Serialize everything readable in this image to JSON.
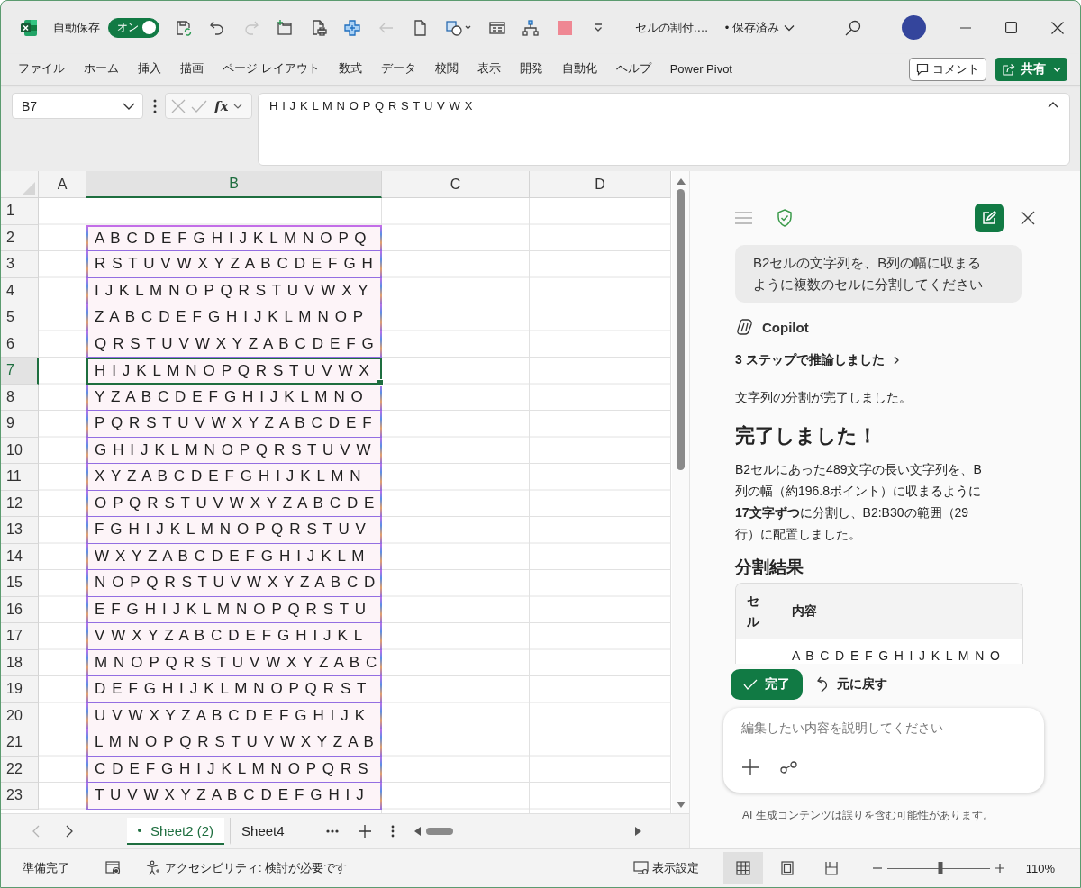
{
  "title_bar": {
    "autosave": {
      "label": "自動保存",
      "toggle_label": "オン",
      "on": true
    },
    "quick_access": [
      {
        "kind": "save",
        "disabled": false
      },
      {
        "kind": "undo",
        "disabled": false
      },
      {
        "kind": "redo",
        "disabled": true
      },
      {
        "kind": "new-sheet",
        "disabled": false
      },
      {
        "kind": "print-preview",
        "disabled": false
      },
      {
        "kind": "cross",
        "disabled": false
      },
      {
        "kind": "back",
        "disabled": true
      },
      {
        "kind": "document",
        "disabled": false
      },
      {
        "kind": "shapes",
        "disabled": false
      },
      {
        "kind": "form",
        "disabled": false
      },
      {
        "kind": "hierarchy",
        "disabled": false
      },
      {
        "kind": "swatch",
        "disabled": false
      },
      {
        "kind": "customize",
        "disabled": false
      }
    ],
    "document_title": "セルの割付.…",
    "save_status": "• 保存済み"
  },
  "ribbon_tabs": [
    {
      "label": "ファイル",
      "selected": false
    },
    {
      "label": "ホーム",
      "selected": false
    },
    {
      "label": "挿入",
      "selected": false
    },
    {
      "label": "描画",
      "selected": false
    },
    {
      "label": "ページ レイアウト",
      "selected": false
    },
    {
      "label": "数式",
      "selected": false
    },
    {
      "label": "データ",
      "selected": false
    },
    {
      "label": "校閲",
      "selected": false
    },
    {
      "label": "表示",
      "selected": false
    },
    {
      "label": "開発",
      "selected": false
    },
    {
      "label": "自動化",
      "selected": false
    },
    {
      "label": "ヘルプ",
      "selected": false
    },
    {
      "label": "Power Pivot",
      "selected": false
    }
  ],
  "ribbon_actions": {
    "comment": "コメント",
    "share": "共有"
  },
  "formula_bar": {
    "name_box": "B7",
    "editing": false,
    "function_label": "fx",
    "formula": "H I J K L M N O P Q R S T U V W X"
  },
  "sheet": {
    "columns": [
      {
        "label": "A",
        "selected": false
      },
      {
        "label": "B",
        "selected": true
      },
      {
        "label": "C",
        "selected": false
      },
      {
        "label": "D",
        "selected": false
      }
    ],
    "rows": [
      {
        "header": "1",
        "selected": false,
        "highlighted": false
      },
      {
        "header": "2",
        "selected": false,
        "highlighted": true,
        "b": "A B C D E F G H I J K L M N O P Q"
      },
      {
        "header": "3",
        "selected": false,
        "highlighted": true,
        "b": "R S T U V W X Y Z A B C D E F G H"
      },
      {
        "header": "4",
        "selected": false,
        "highlighted": true,
        "b": "I J K L M N O P Q R S T U V W X Y"
      },
      {
        "header": "5",
        "selected": false,
        "highlighted": true,
        "b": "Z A B C D E F G H I J K L M N O P"
      },
      {
        "header": "6",
        "selected": false,
        "highlighted": true,
        "b": "Q R S T U V W X Y Z A B C D E F G"
      },
      {
        "header": "7",
        "selected": true,
        "highlighted": true,
        "b": "H I J K L M N O P Q R S T U V W X"
      },
      {
        "header": "8",
        "selected": false,
        "highlighted": true,
        "b": "Y Z A B C D E F G H I J K L M N O"
      },
      {
        "header": "9",
        "selected": false,
        "highlighted": true,
        "b": "P Q R S T U V W X Y Z A B C D E F"
      },
      {
        "header": "10",
        "selected": false,
        "highlighted": true,
        "b": "G H I J K L M N O P Q R S T U V W"
      },
      {
        "header": "11",
        "selected": false,
        "highlighted": true,
        "b": "X Y Z A B C D E F G H I J K L M N"
      },
      {
        "header": "12",
        "selected": false,
        "highlighted": true,
        "b": "O P Q R S T U V W X Y Z A B C D E"
      },
      {
        "header": "13",
        "selected": false,
        "highlighted": true,
        "b": "F G H I J K L M N O P Q R S T U V"
      },
      {
        "header": "14",
        "selected": false,
        "highlighted": true,
        "b": "W X Y Z A B C D E F G H I J K L M"
      },
      {
        "header": "15",
        "selected": false,
        "highlighted": true,
        "b": "N O P Q R S T U V W X Y Z A B C D"
      },
      {
        "header": "16",
        "selected": false,
        "highlighted": true,
        "b": "E F G H I J K L M N O P Q R S T U"
      },
      {
        "header": "17",
        "selected": false,
        "highlighted": true,
        "b": "V W X Y Z A B C D E F G H I J K L"
      },
      {
        "header": "18",
        "selected": false,
        "highlighted": true,
        "b": "M N O P Q R S T U V W X Y Z A B C"
      },
      {
        "header": "19",
        "selected": false,
        "highlighted": true,
        "b": "D E F G H I J K L M N O P Q R S T"
      },
      {
        "header": "20",
        "selected": false,
        "highlighted": true,
        "b": "U V W X Y Z A B C D E F G H I J K"
      },
      {
        "header": "21",
        "selected": false,
        "highlighted": true,
        "b": "L M N O P Q R S T U V W X Y Z A B"
      },
      {
        "header": "22",
        "selected": false,
        "highlighted": true,
        "b": "C D E F G H I J K L M N O P Q R S"
      },
      {
        "header": "23",
        "selected": false,
        "highlighted": true,
        "b": "T U V W X Y Z A B C D E F G H I J"
      }
    ]
  },
  "sheet_tabs": {
    "nav": [
      {
        "kind": "previous",
        "disabled": true
      },
      {
        "kind": "next",
        "disabled": false
      }
    ],
    "tabs": [
      {
        "label": "Sheet2 (2)",
        "selected": true
      },
      {
        "label": "Sheet4",
        "selected": false
      }
    ]
  },
  "status_bar": {
    "status": "準備完了",
    "accessibility": "アクセシビリティ: 検討が必要です",
    "display_settings": "表示設定",
    "views": [
      {
        "kind": "normal",
        "selected": true
      },
      {
        "kind": "page-layout",
        "selected": false
      },
      {
        "kind": "page-break",
        "selected": false
      }
    ],
    "zoom": {
      "level": 0.52,
      "label": "110%"
    }
  },
  "copilot": {
    "user_message": "B2セルの文字列を、B列の幅に収まるように複数のセルに分割してください",
    "assistant_name": "Copilot",
    "reasoning": "3 ステップで推論しました",
    "intro": "文字列の分割が完了しました。",
    "heading": "完了しました！",
    "summary": "B2セルにあった489文字の長い文字列を、B列の幅（約196.8ポイント）に収まるように**17文字ずつ**に分割し、B2:B30の範囲（29行）に配置しました。",
    "result_heading": "分割結果",
    "table": {
      "columns": [
        "セル",
        "内容"
      ],
      "rows": [
        {
          "content": "A B C D E F G H I J K L M N O"
        }
      ]
    },
    "actions": [
      {
        "kind": "accept",
        "label": "完了"
      },
      {
        "kind": "undo",
        "label": "元に戻す"
      }
    ],
    "prompt": {
      "placeholder": "編集したい内容を説明してください"
    },
    "disclaimer": "AI 生成コンテンツは誤りを含む可能性があります。"
  }
}
